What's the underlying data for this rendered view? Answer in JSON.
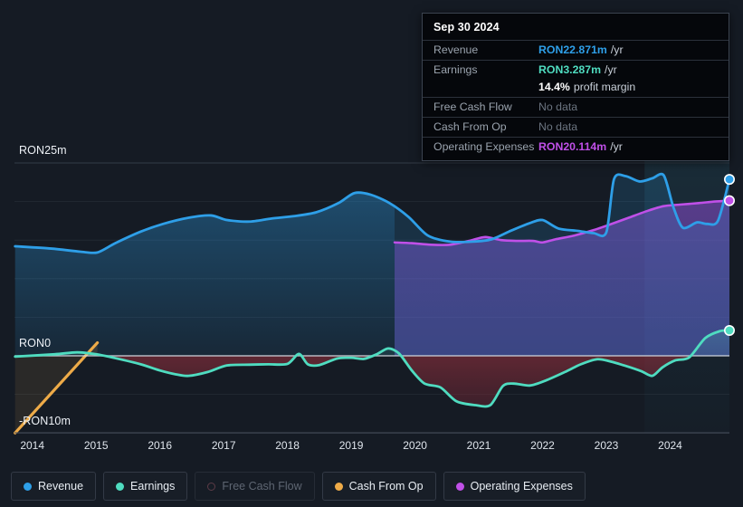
{
  "chart_data": {
    "type": "area",
    "title": "",
    "xlabel": "",
    "ylabel": "",
    "currency": "RON",
    "xlim": [
      2013.72,
      2024.93
    ],
    "ylim": [
      -11.3,
      26.9
    ],
    "grid": true,
    "zero_line": 0,
    "axis_ticks_y": [
      "RON25m",
      "RON0",
      "-RON10m"
    ],
    "axis_tick_values_y": [
      25,
      0,
      -10
    ],
    "categories": [
      "2014",
      "2015",
      "2016",
      "2017",
      "2018",
      "2019",
      "2020",
      "2021",
      "2022",
      "2023",
      "2024"
    ],
    "forecast_band_start": 2023.6,
    "series": [
      {
        "name": "Revenue",
        "color": "#2e9fe8",
        "enabled": true,
        "points": [
          [
            2013.73,
            14.2
          ],
          [
            2014.3,
            13.9
          ],
          [
            2014.75,
            13.5
          ],
          [
            2015.02,
            13.4
          ],
          [
            2015.3,
            14.6
          ],
          [
            2015.7,
            16.1
          ],
          [
            2016.05,
            17.1
          ],
          [
            2016.45,
            17.9
          ],
          [
            2016.8,
            18.2
          ],
          [
            2017.05,
            17.6
          ],
          [
            2017.4,
            17.4
          ],
          [
            2017.75,
            17.8
          ],
          [
            2018.1,
            18.1
          ],
          [
            2018.45,
            18.6
          ],
          [
            2018.8,
            19.8
          ],
          [
            2019.05,
            21.1
          ],
          [
            2019.3,
            20.9
          ],
          [
            2019.6,
            19.8
          ],
          [
            2019.9,
            18.0
          ],
          [
            2020.2,
            15.6
          ],
          [
            2020.55,
            14.8
          ],
          [
            2020.9,
            14.8
          ],
          [
            2021.2,
            15.1
          ],
          [
            2021.5,
            16.2
          ],
          [
            2021.8,
            17.2
          ],
          [
            2022.0,
            17.6
          ],
          [
            2022.25,
            16.5
          ],
          [
            2022.55,
            16.2
          ],
          [
            2022.8,
            15.9
          ],
          [
            2023.0,
            16.0
          ],
          [
            2023.12,
            22.9
          ],
          [
            2023.3,
            23.3
          ],
          [
            2023.52,
            22.6
          ],
          [
            2023.72,
            23.0
          ],
          [
            2023.9,
            23.4
          ],
          [
            2024.05,
            19.3
          ],
          [
            2024.2,
            16.6
          ],
          [
            2024.42,
            17.3
          ],
          [
            2024.58,
            17.1
          ],
          [
            2024.75,
            17.5
          ],
          [
            2024.93,
            22.87
          ]
        ],
        "end_value": 22.871
      },
      {
        "name": "Earnings",
        "color": "#4fdcc0",
        "enabled": true,
        "points": [
          [
            2013.73,
            -0.1
          ],
          [
            2014.35,
            0.2
          ],
          [
            2014.7,
            0.45
          ],
          [
            2015.0,
            0.2
          ],
          [
            2015.3,
            -0.3
          ],
          [
            2015.7,
            -1.1
          ],
          [
            2016.0,
            -1.9
          ],
          [
            2016.25,
            -2.4
          ],
          [
            2016.45,
            -2.6
          ],
          [
            2016.75,
            -2.1
          ],
          [
            2017.05,
            -1.25
          ],
          [
            2017.4,
            -1.15
          ],
          [
            2017.7,
            -1.1
          ],
          [
            2018.0,
            -1.05
          ],
          [
            2018.18,
            0.25
          ],
          [
            2018.32,
            -1.1
          ],
          [
            2018.5,
            -1.2
          ],
          [
            2018.78,
            -0.35
          ],
          [
            2019.0,
            -0.25
          ],
          [
            2019.2,
            -0.4
          ],
          [
            2019.4,
            0.2
          ],
          [
            2019.58,
            0.95
          ],
          [
            2019.75,
            0.3
          ],
          [
            2019.95,
            -1.9
          ],
          [
            2020.15,
            -3.6
          ],
          [
            2020.4,
            -4.1
          ],
          [
            2020.65,
            -5.9
          ],
          [
            2020.95,
            -6.4
          ],
          [
            2021.18,
            -6.4
          ],
          [
            2021.38,
            -3.9
          ],
          [
            2021.55,
            -3.6
          ],
          [
            2021.8,
            -3.85
          ],
          [
            2022.05,
            -3.2
          ],
          [
            2022.35,
            -2.1
          ],
          [
            2022.6,
            -1.1
          ],
          [
            2022.85,
            -0.45
          ],
          [
            2023.05,
            -0.7
          ],
          [
            2023.3,
            -1.3
          ],
          [
            2023.55,
            -2.0
          ],
          [
            2023.72,
            -2.6
          ],
          [
            2023.88,
            -1.5
          ],
          [
            2024.08,
            -0.6
          ],
          [
            2024.3,
            -0.2
          ],
          [
            2024.55,
            2.3
          ],
          [
            2024.78,
            3.2
          ],
          [
            2024.93,
            3.287
          ]
        ],
        "end_value": 3.287
      },
      {
        "name": "Free Cash Flow",
        "color": "#e05b78",
        "enabled": false,
        "points": [],
        "end_value": null
      },
      {
        "name": "Cash From Op",
        "color": "#eeab48",
        "enabled": true,
        "points": [
          [
            2013.73,
            -10.0
          ],
          [
            2015.02,
            1.7
          ]
        ],
        "end_value": null
      },
      {
        "name": "Operating Expenses",
        "color": "#c050e8",
        "enabled": true,
        "points": [
          [
            2019.68,
            14.7
          ],
          [
            2019.95,
            14.6
          ],
          [
            2020.25,
            14.4
          ],
          [
            2020.55,
            14.4
          ],
          [
            2020.85,
            14.9
          ],
          [
            2021.1,
            15.4
          ],
          [
            2021.35,
            15.0
          ],
          [
            2021.6,
            14.9
          ],
          [
            2021.85,
            14.9
          ],
          [
            2022.0,
            14.7
          ],
          [
            2022.2,
            15.1
          ],
          [
            2022.5,
            15.6
          ],
          [
            2022.8,
            16.3
          ],
          [
            2023.05,
            17.0
          ],
          [
            2023.35,
            17.9
          ],
          [
            2023.65,
            18.8
          ],
          [
            2023.9,
            19.4
          ],
          [
            2024.15,
            19.6
          ],
          [
            2024.45,
            19.8
          ],
          [
            2024.7,
            20.0
          ],
          [
            2024.93,
            20.114
          ]
        ],
        "end_value": 20.114
      }
    ]
  },
  "tooltip": {
    "date": "Sep 30 2024",
    "rows": [
      {
        "key": "Revenue",
        "value": "RON22.871m",
        "unit": "/yr",
        "color": "#2e9fe8",
        "no_data": false
      },
      {
        "key": "Earnings",
        "value": "RON3.287m",
        "unit": "/yr",
        "color": "#4fdcc0",
        "no_data": false
      },
      {
        "key": "",
        "value": "14.4%",
        "unit": "profit margin",
        "color": "#ffffff",
        "no_data": false,
        "sub": true
      },
      {
        "key": "Free Cash Flow",
        "value": "No data",
        "unit": "",
        "color": "#6b7480",
        "no_data": true
      },
      {
        "key": "Cash From Op",
        "value": "No data",
        "unit": "",
        "color": "#6b7480",
        "no_data": true
      },
      {
        "key": "Operating Expenses",
        "value": "RON20.114m",
        "unit": "/yr",
        "color": "#c050e8",
        "no_data": false
      }
    ]
  },
  "legend": {
    "items": [
      {
        "label": "Revenue",
        "color": "#2e9fe8",
        "enabled": true
      },
      {
        "label": "Earnings",
        "color": "#4fdcc0",
        "enabled": true
      },
      {
        "label": "Free Cash Flow",
        "color": "#e05b78",
        "enabled": false
      },
      {
        "label": "Cash From Op",
        "color": "#eeab48",
        "enabled": true
      },
      {
        "label": "Operating Expenses",
        "color": "#c050e8",
        "enabled": true
      }
    ]
  }
}
